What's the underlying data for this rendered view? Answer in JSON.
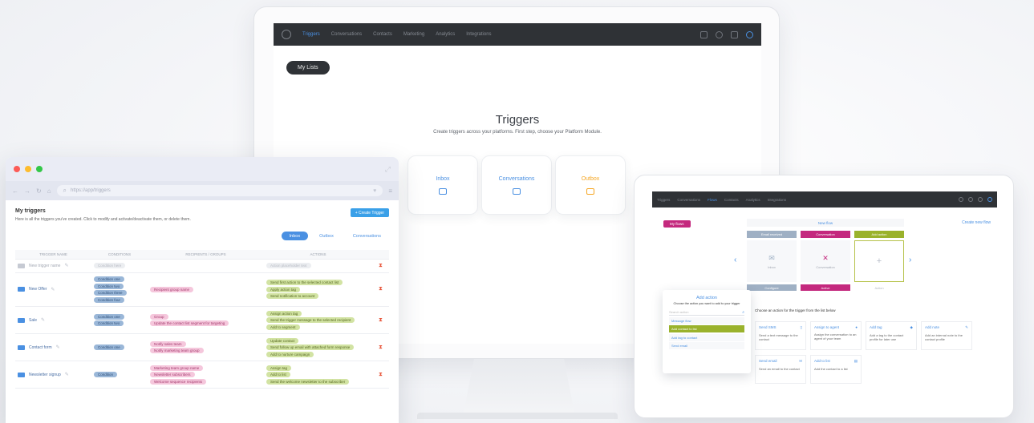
{
  "monitor": {
    "nav": {
      "items": [
        "Triggers",
        "Conversations",
        "Contacts",
        "Marketing",
        "Analytics",
        "Integrations"
      ],
      "active_index": 0
    },
    "my_lists_label": "My Lists",
    "title": "Triggers",
    "subtitle": "Create triggers across your platforms. First step, choose your Platform Module.",
    "cards": [
      {
        "label": "Inbox",
        "icon": "inbox-icon",
        "color": "#4a90e2"
      },
      {
        "label": "Conversations",
        "icon": "chat-icon",
        "color": "#4a90e2"
      },
      {
        "label": "Outbox",
        "icon": "outbox-icon",
        "color": "#f5a623"
      }
    ]
  },
  "browser": {
    "url": "https://app/triggers",
    "title": "My triggers",
    "description": "Here is all the triggers you've created. Click to modify and activate/deactivate them, or delete them.",
    "create_label": "+ Create Trigger",
    "tabs": [
      "Inbox",
      "Outbox",
      "Conversations"
    ],
    "active_tab": 0,
    "columns": [
      "TRIGGER NAME",
      "CONDITIONS",
      "RECIPIENTS / GROUPS",
      "ACTIONS",
      ""
    ],
    "rows": [
      {
        "name": "New trigger name",
        "disabled": true,
        "conditions": [
          "Condition here"
        ],
        "recipients": [],
        "actions": [
          "Action placeholder text"
        ]
      },
      {
        "name": "New Offer",
        "disabled": false,
        "conditions": [
          "Condition one",
          "Condition two",
          "Condition three",
          "Condition four"
        ],
        "recipients": [
          "Recipient group name"
        ],
        "actions": [
          "Send first action to the selected contact list",
          "Apply action tag",
          "Send notification to account"
        ]
      },
      {
        "name": "Sale",
        "disabled": false,
        "conditions": [
          "Condition one",
          "Condition two"
        ],
        "recipients": [
          "Group",
          "Update the contact list segment for targeting"
        ],
        "actions": [
          "Assign action tag",
          "Send the trigger message to the selected recipient",
          "Add to segment"
        ]
      },
      {
        "name": "Contact form",
        "disabled": false,
        "conditions": [
          "Condition one"
        ],
        "recipients": [
          "Notify sales team",
          "Notify marketing team group"
        ],
        "actions": [
          "Update contact",
          "Send follow up email with attached form response",
          "Add to nurture campaign"
        ]
      },
      {
        "name": "Newsletter signup",
        "disabled": false,
        "conditions": [
          "Condition"
        ],
        "recipients": [
          "Marketing team group name",
          "Newsletter subscribers",
          "Welcome sequence recipients"
        ],
        "actions": [
          "Assign tag",
          "Add to list",
          "Send the welcome newsletter to the subscriber"
        ]
      }
    ]
  },
  "tablet": {
    "nav": {
      "items": [
        "Triggers",
        "Conversations",
        "Flows",
        "Contacts",
        "Analytics",
        "Integrations"
      ],
      "active_index": 2
    },
    "left_button": "My flows",
    "right_link": "Create new flow",
    "carousel_title": "New flow",
    "columns": [
      {
        "head": "Email received",
        "head_color": "#9fb0c4",
        "body": "Inbox",
        "foot": "Configure",
        "foot_color": "#9fb0c4"
      },
      {
        "head": "Conversation",
        "head_color": "#c4297e",
        "body": "Conversation",
        "foot": "Active",
        "foot_color": "#c4297e"
      },
      {
        "head": "Add action",
        "head_color": "#9ab22c",
        "body": "",
        "foot": "Action",
        "foot_color": "#ffffff"
      }
    ],
    "dropdown": {
      "title": "Add action",
      "subtitle": "Choose the action you want to add to your trigger",
      "search_placeholder": "Search action",
      "items": [
        "Message flow",
        "Add contact to list",
        "Add tag to contact",
        "Send email"
      ],
      "selected_index": 1
    },
    "section_text": "Choose an action for the trigger from the list below",
    "action_cards": [
      {
        "title": "Send SMS",
        "desc": "Send a text message to the contact"
      },
      {
        "title": "Assign to agent",
        "desc": "Assign the conversation to an agent of your team"
      },
      {
        "title": "Add tag",
        "desc": "Add a tag to the contact profile for later use"
      },
      {
        "title": "Add note",
        "desc": "Add an internal note to the contact profile"
      },
      {
        "title": "Send email",
        "desc": "Send an email to the contact"
      },
      {
        "title": "Add to list",
        "desc": "Add the contact to a list"
      }
    ]
  }
}
